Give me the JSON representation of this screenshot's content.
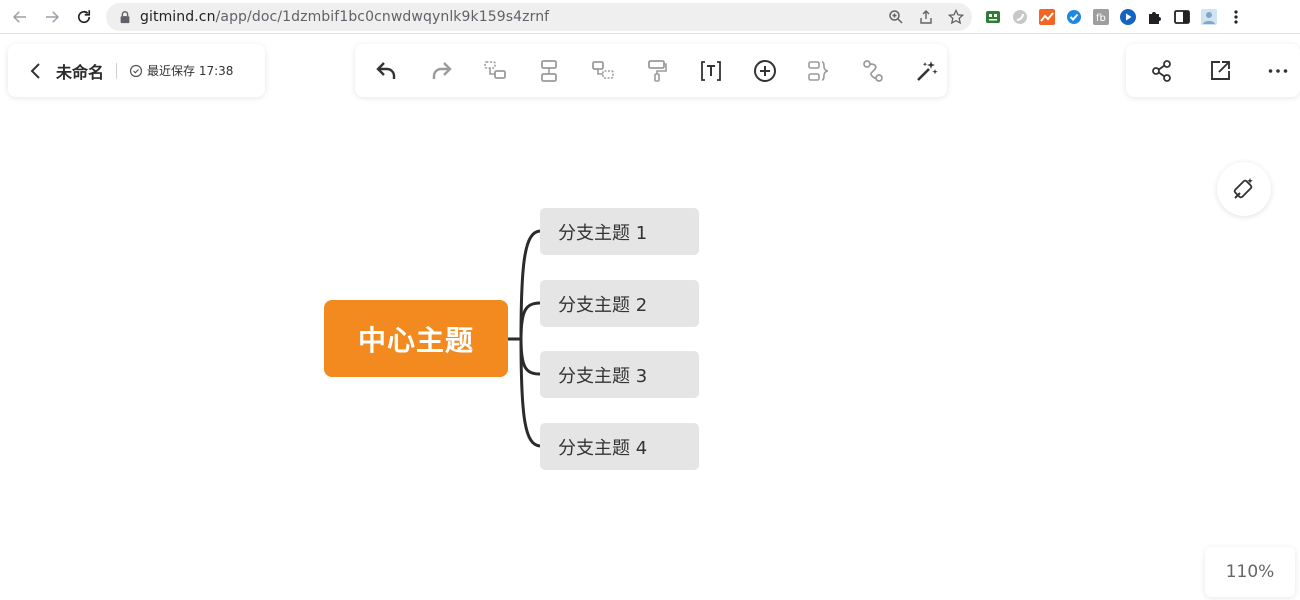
{
  "browser": {
    "url_host": "gitmind.cn",
    "url_path": "/app/doc/1dzmbif1bc0cnwdwqynlk9k159s4zrnf"
  },
  "doc": {
    "title": "未命名",
    "save_status": "最近保存 17:38"
  },
  "toolbar": {
    "tools": [
      "undo-icon",
      "redo-icon",
      "insert-child-topic-icon",
      "insert-sibling-topic-icon",
      "insert-parent-topic-icon",
      "format-painter-icon",
      "text-icon",
      "add-icon",
      "summary-icon",
      "relation-icon",
      "ai-magic-icon"
    ]
  },
  "right_actions": [
    "share-icon",
    "export-icon",
    "more-icon"
  ],
  "mindmap": {
    "central": "中心主题",
    "branches": [
      "分支主题 1",
      "分支主题 2",
      "分支主题 3",
      "分支主题 4"
    ],
    "central_color": "#f28a20",
    "branch_color": "#e5e5e5"
  },
  "zoom": "110%"
}
